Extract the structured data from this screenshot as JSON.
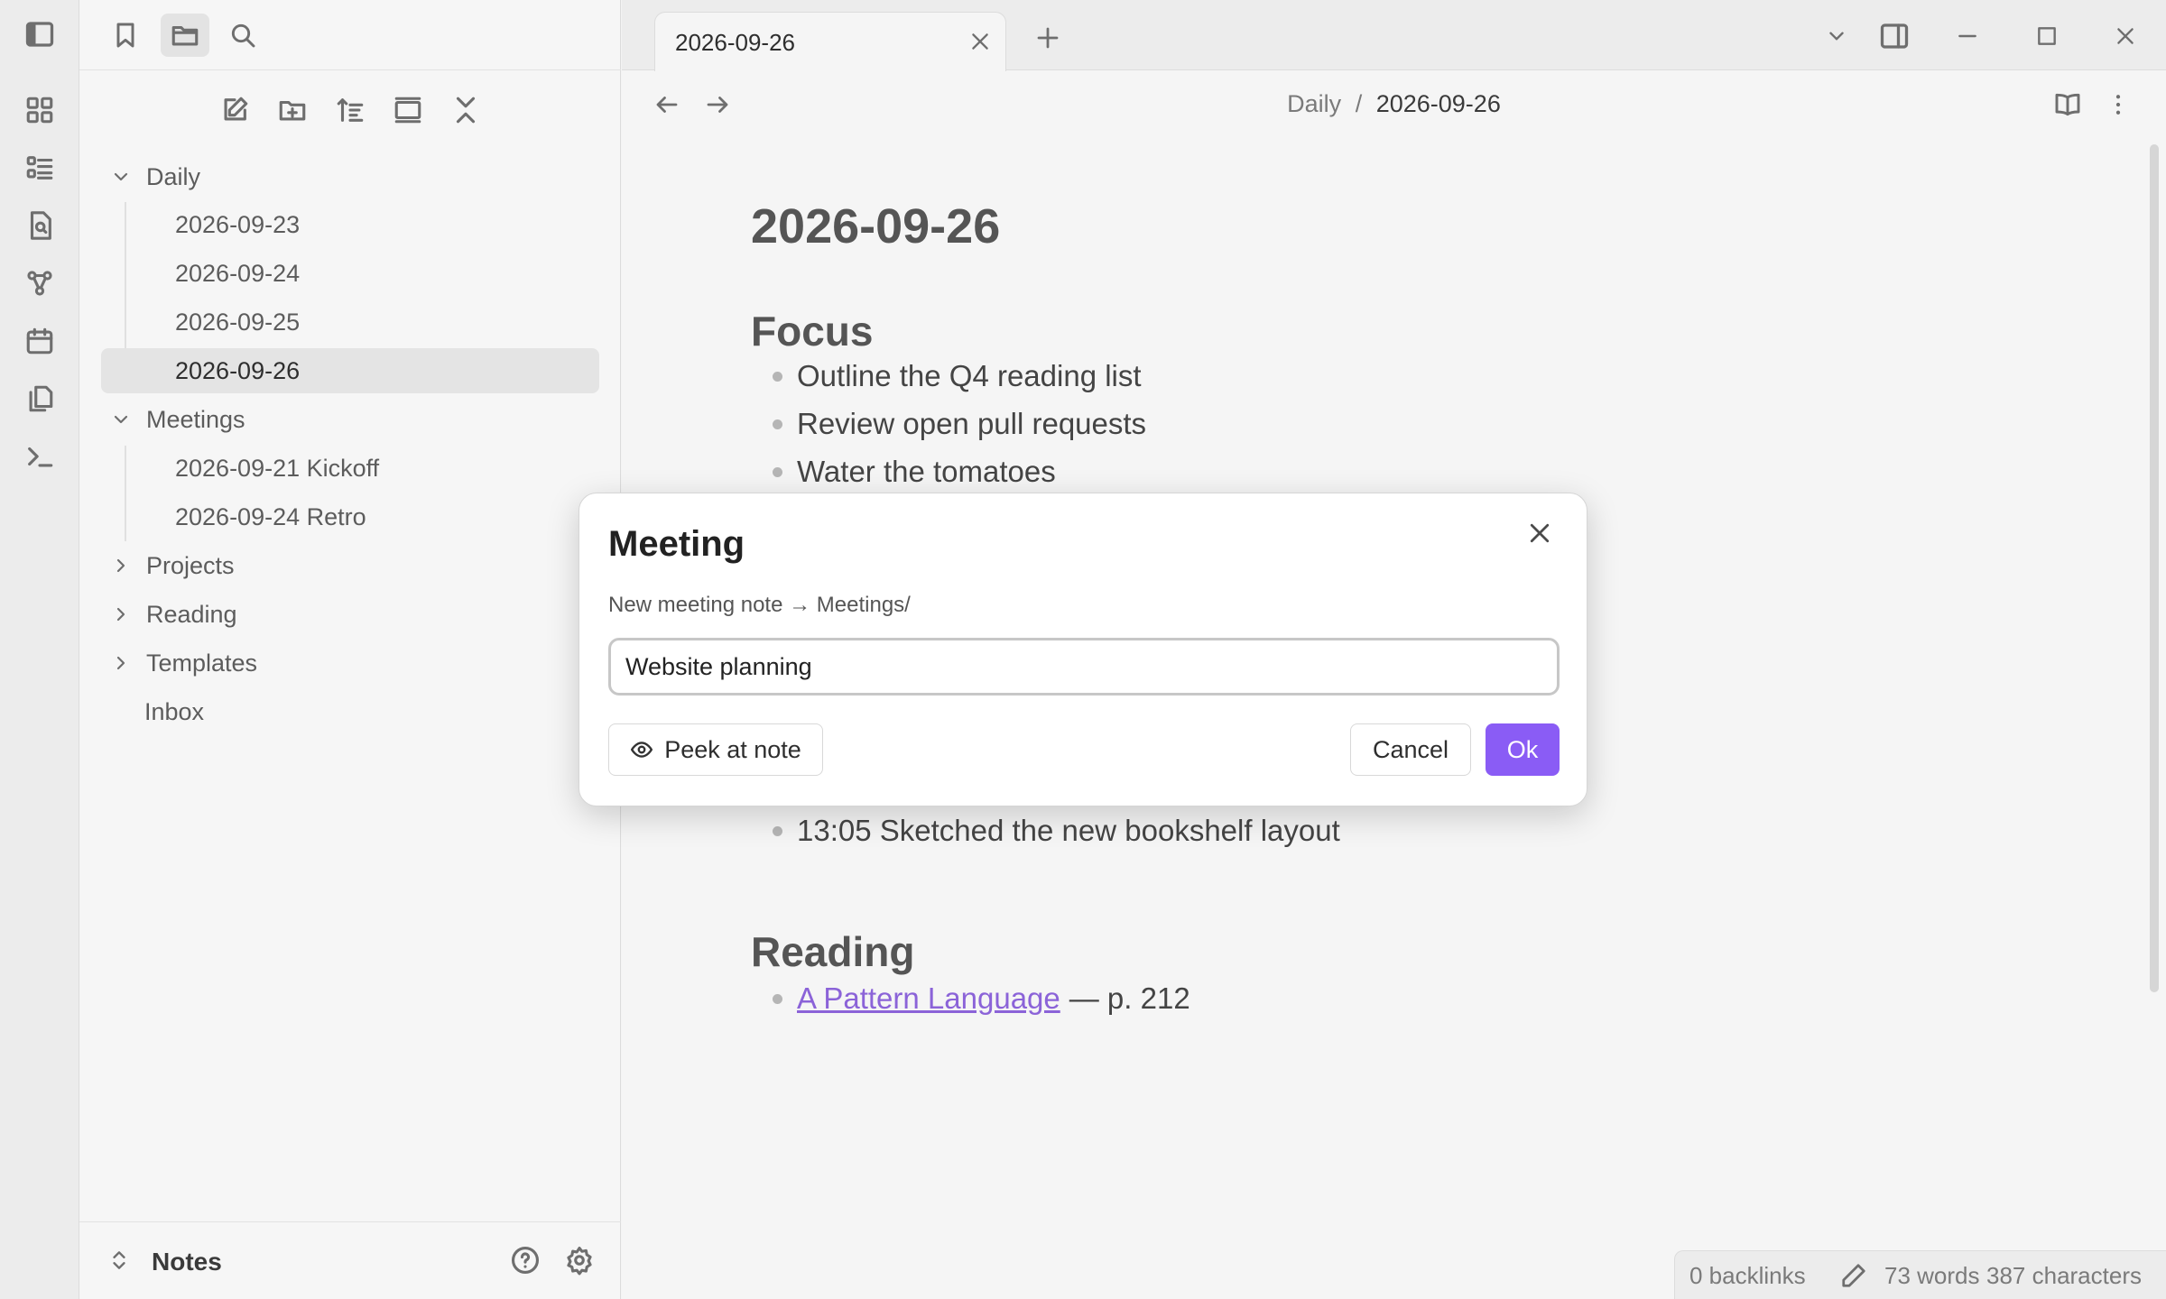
{
  "sidebar": {
    "tree": [
      {
        "label": "Daily",
        "type": "folder",
        "expanded": true
      },
      {
        "label": "2026-09-23",
        "type": "file"
      },
      {
        "label": "2026-09-24",
        "type": "file"
      },
      {
        "label": "2026-09-25",
        "type": "file"
      },
      {
        "label": "2026-09-26",
        "type": "file",
        "selected": true
      },
      {
        "label": "Meetings",
        "type": "folder",
        "expanded": true
      },
      {
        "label": "2026-09-21 Kickoff",
        "type": "file"
      },
      {
        "label": "2026-09-24 Retro",
        "type": "file"
      },
      {
        "label": "Projects",
        "type": "folder",
        "expanded": false
      },
      {
        "label": "Reading",
        "type": "folder",
        "expanded": false
      },
      {
        "label": "Templates",
        "type": "folder",
        "expanded": false
      },
      {
        "label": "Inbox",
        "type": "file"
      }
    ],
    "vault_name": "Notes"
  },
  "tab": {
    "title": "2026-09-26"
  },
  "breadcrumb": {
    "folder": "Daily",
    "separator": "/",
    "current": "2026-09-26"
  },
  "note": {
    "title": "2026-09-26",
    "focus_heading": "Focus",
    "focus_items": [
      "Outline the Q4 reading list",
      "Review open pull requests",
      "Water the tomatoes"
    ],
    "log_item": "13:05 Sketched the new bookshelf layout",
    "reading_heading": "Reading",
    "reading_link": "A Pattern Language",
    "reading_suffix": "— p. 212"
  },
  "status": {
    "backlinks": "0 backlinks",
    "words": "73 words",
    "characters": "387 characters"
  },
  "modal": {
    "title": "Meeting",
    "description": "New meeting note → Meetings/",
    "input_value": "Website planning",
    "peek_label": "Peek at note",
    "cancel_label": "Cancel",
    "ok_label": "Ok"
  },
  "colors": {
    "accent": "#8a5cf5",
    "link": "#8b63d8"
  }
}
